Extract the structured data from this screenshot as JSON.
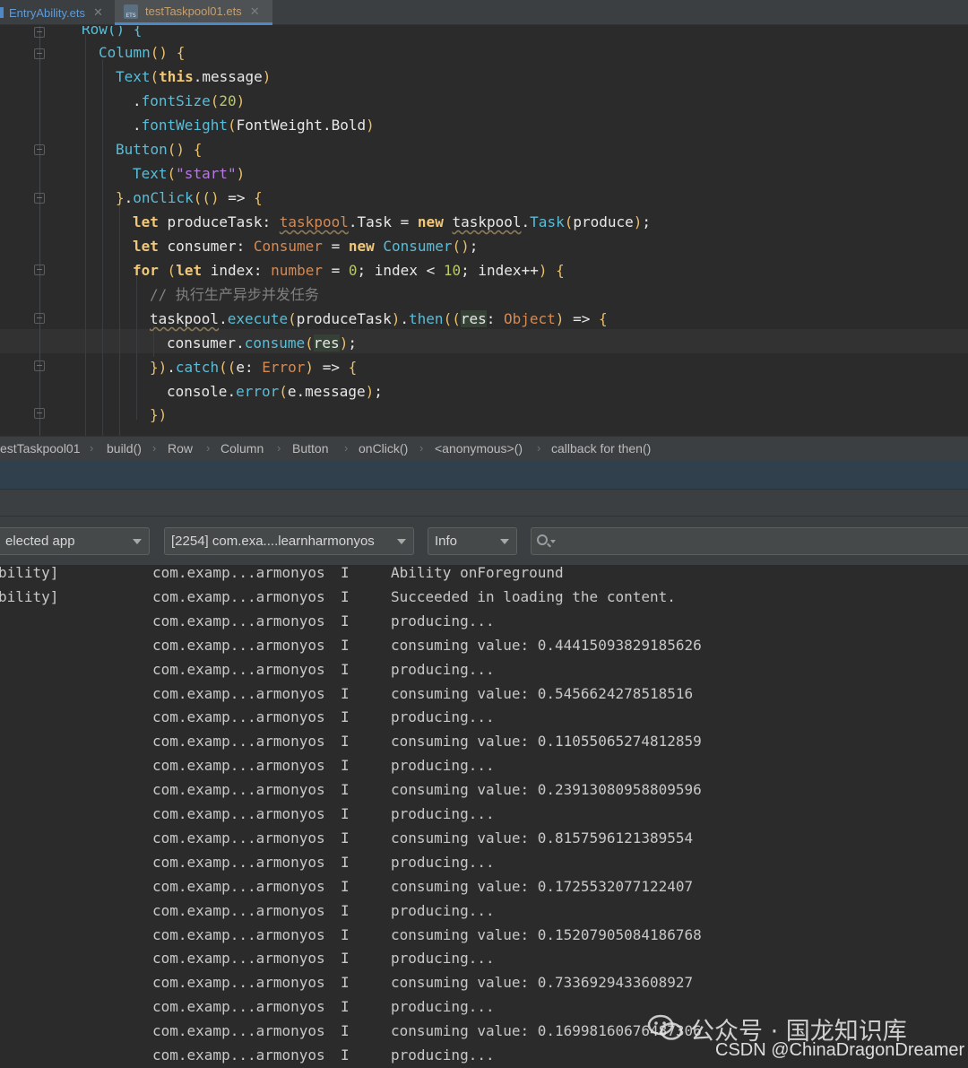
{
  "tabs": [
    {
      "label": "EntryAbility.ets",
      "active": false
    },
    {
      "label": "testTaskpool01.ets",
      "active": true
    }
  ],
  "colors": {
    "editor_bg": "#2b2b2b",
    "panel_bg": "#3c3f41",
    "tab_active_underline": "#4a88c7"
  },
  "code": {
    "row_frag": "Row() {",
    "column_kw": "Column",
    "text_kw": "Text",
    "this_kw": "this",
    "message": "message",
    "fontSize": "fontSize",
    "n20": "20",
    "fontWeight": "fontWeight",
    "FontWeight_Bold": "FontWeight.Bold",
    "button_kw": "Button",
    "start_str": "\"start\"",
    "onClick": "onClick",
    "let_kw": "let",
    "produceTask": "produceTask",
    "taskpool": "taskpool",
    "Task": "Task",
    "new_kw": "new",
    "produce": "produce",
    "consumer": "consumer",
    "Consumer": "Consumer",
    "for_kw": "for",
    "index": "index",
    "number_t": "number",
    "n0": "0",
    "n10": "10",
    "comment": "// 执行生产异步并发任务",
    "execute": "execute",
    "then": "then",
    "res": "res",
    "Object": "Object",
    "consume": "consume",
    "catch": "catch",
    "e": "e",
    "Error": "Error",
    "console": "console",
    "error": "error"
  },
  "breadcrumb": [
    "estTaskpool01",
    "build()",
    "Row",
    "Column",
    "Button",
    "onClick()",
    "<anonymous>()",
    "callback for then()"
  ],
  "toolbar": {
    "app_select": "elected app",
    "process_select": "[2254] com.exa....learnharmonyos",
    "level_select": "Info",
    "search_placeholder": ""
  },
  "log_rows": [
    {
      "tag": "bility]",
      "pkg": "com.examp...armonyos",
      "level": "I",
      "msg": "Ability onForeground"
    },
    {
      "tag": "bility]",
      "pkg": "com.examp...armonyos",
      "level": "I",
      "msg": "Succeeded in loading the content."
    },
    {
      "tag": "",
      "pkg": "com.examp...armonyos",
      "level": "I",
      "msg": "producing..."
    },
    {
      "tag": "",
      "pkg": "com.examp...armonyos",
      "level": "I",
      "msg": "consuming value: 0.44415093829185626"
    },
    {
      "tag": "",
      "pkg": "com.examp...armonyos",
      "level": "I",
      "msg": "producing..."
    },
    {
      "tag": "",
      "pkg": "com.examp...armonyos",
      "level": "I",
      "msg": "consuming value: 0.5456624278518516"
    },
    {
      "tag": "",
      "pkg": "com.examp...armonyos",
      "level": "I",
      "msg": "producing..."
    },
    {
      "tag": "",
      "pkg": "com.examp...armonyos",
      "level": "I",
      "msg": "consuming value: 0.11055065274812859"
    },
    {
      "tag": "",
      "pkg": "com.examp...armonyos",
      "level": "I",
      "msg": "producing..."
    },
    {
      "tag": "",
      "pkg": "com.examp...armonyos",
      "level": "I",
      "msg": "consuming value: 0.23913080958809596"
    },
    {
      "tag": "",
      "pkg": "com.examp...armonyos",
      "level": "I",
      "msg": "producing..."
    },
    {
      "tag": "",
      "pkg": "com.examp...armonyos",
      "level": "I",
      "msg": "consuming value: 0.8157596121389554"
    },
    {
      "tag": "",
      "pkg": "com.examp...armonyos",
      "level": "I",
      "msg": "producing..."
    },
    {
      "tag": "",
      "pkg": "com.examp...armonyos",
      "level": "I",
      "msg": "consuming value: 0.1725532077122407"
    },
    {
      "tag": "",
      "pkg": "com.examp...armonyos",
      "level": "I",
      "msg": "producing..."
    },
    {
      "tag": "",
      "pkg": "com.examp...armonyos",
      "level": "I",
      "msg": "consuming value: 0.15207905084186768"
    },
    {
      "tag": "",
      "pkg": "com.examp...armonyos",
      "level": "I",
      "msg": "producing..."
    },
    {
      "tag": "",
      "pkg": "com.examp...armonyos",
      "level": "I",
      "msg": "consuming value: 0.7336929433608927"
    },
    {
      "tag": "",
      "pkg": "com.examp...armonyos",
      "level": "I",
      "msg": "producing..."
    },
    {
      "tag": "",
      "pkg": "com.examp...armonyos",
      "level": "I",
      "msg": "consuming value: 0.16998160676487306"
    },
    {
      "tag": "",
      "pkg": "com.examp...armonyos",
      "level": "I",
      "msg": "producing..."
    }
  ],
  "watermark": {
    "line1": "公众号 · 国龙知识库",
    "line2": "CSDN @ChinaDragonDreamer"
  }
}
